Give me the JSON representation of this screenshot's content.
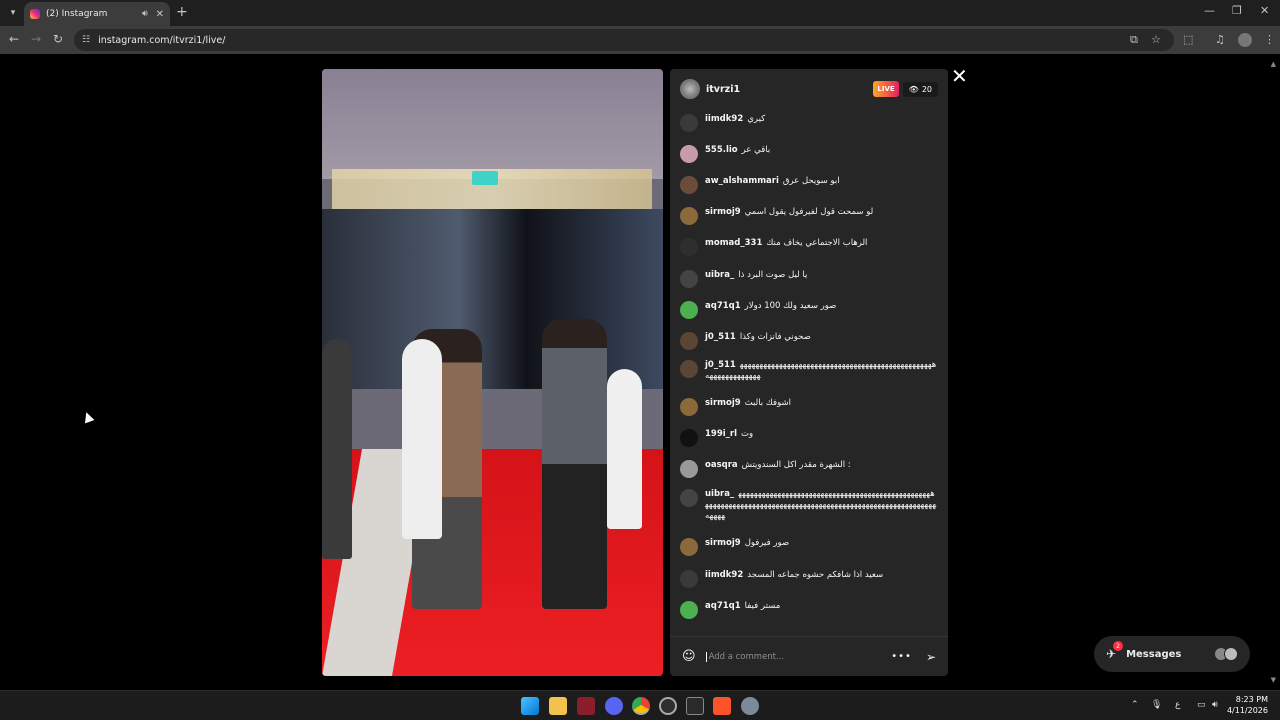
{
  "browser": {
    "tab_title": "(2) Instagram",
    "url": "instagram.com/itvrzi1/live/",
    "icons": {
      "tab_list": "chevron-down-icon",
      "speaker": "speaker-icon",
      "tab_close": "close-icon",
      "new_tab": "plus-icon",
      "back": "arrow-left-icon",
      "forward": "arrow-right-icon",
      "reload": "reload-icon",
      "site_info": "tune-icon",
      "install": "install-icon",
      "bookmark": "star-icon",
      "extensions": "puzzle-icon",
      "media": "media-icon",
      "menu": "kebab-icon"
    }
  },
  "live": {
    "host": "itvrzi1",
    "badge": "LIVE",
    "viewer_count": "20",
    "comments": [
      {
        "user": "iimdk92",
        "text": "كيري",
        "color": "#3a3a3a"
      },
      {
        "user": "555.lio",
        "text": "باقي عر",
        "color": "#c99aa8"
      },
      {
        "user": "aw_alshammari",
        "text": "ابو سويحل عرق",
        "color": "#6b4b3a"
      },
      {
        "user": "sirmoj9",
        "text": "لو سمحت قول لفيرفول يقول اسمي",
        "color": "#8a6a3a"
      },
      {
        "user": "momad_331",
        "text": "الرهاب الاجتماعي يخاف منك",
        "color": "#2e2e2e"
      },
      {
        "user": "uibra_",
        "text": "يا ليل صوت البرد ذا",
        "color": "#444"
      },
      {
        "user": "aq71q1",
        "text": "صور سعيد ولك 100 دولار",
        "color": "#4caf50"
      },
      {
        "user": "j0_511",
        "text": "صحوني فانزات وكذا",
        "color": "#5a4632"
      },
      {
        "user": "j0_511",
        "text": "هههههههههههههههههههههههههههههههههههههههههههههههههههههههههههههههه",
        "color": "#5a4632"
      },
      {
        "user": "sirmoj9",
        "text": "اشوفك بالبث",
        "color": "#8a6a3a"
      },
      {
        "user": "199i_rl",
        "text": "وت",
        "color": "#111"
      },
      {
        "user": "oasqra",
        "text": "الشهرة مقدر اكل السندويتش :",
        "color": "#999"
      },
      {
        "user": "uibra_",
        "text": "هههههههههههههههههههههههههههههههههههههههههههههههههههههههههههههههههههههههههههههههههههههههههههههههههههههههههههههههههه",
        "color": "#444"
      },
      {
        "user": "sirmoj9",
        "text": "صور فيرفول",
        "color": "#8a6a3a"
      },
      {
        "user": "iimdk92",
        "text": "سعيد اذا شافكم حشوه جماعه المسجد",
        "color": "#3a3a3a"
      },
      {
        "user": "aq71q1",
        "text": "مستر فيفا",
        "color": "#4caf50"
      }
    ],
    "comment_placeholder": "Add a comment..."
  },
  "messages": {
    "label": "Messages",
    "badge": "2"
  },
  "taskbar": {
    "time": "8:23 PM",
    "date": "4/11/2026",
    "lang": "ع",
    "apps": [
      "windows-start-icon",
      "file-explorer-icon",
      "autodesk-icon",
      "discord-icon",
      "chrome-icon",
      "obs-icon",
      "epic-games-icon",
      "brave-icon",
      "settings-icon"
    ]
  }
}
